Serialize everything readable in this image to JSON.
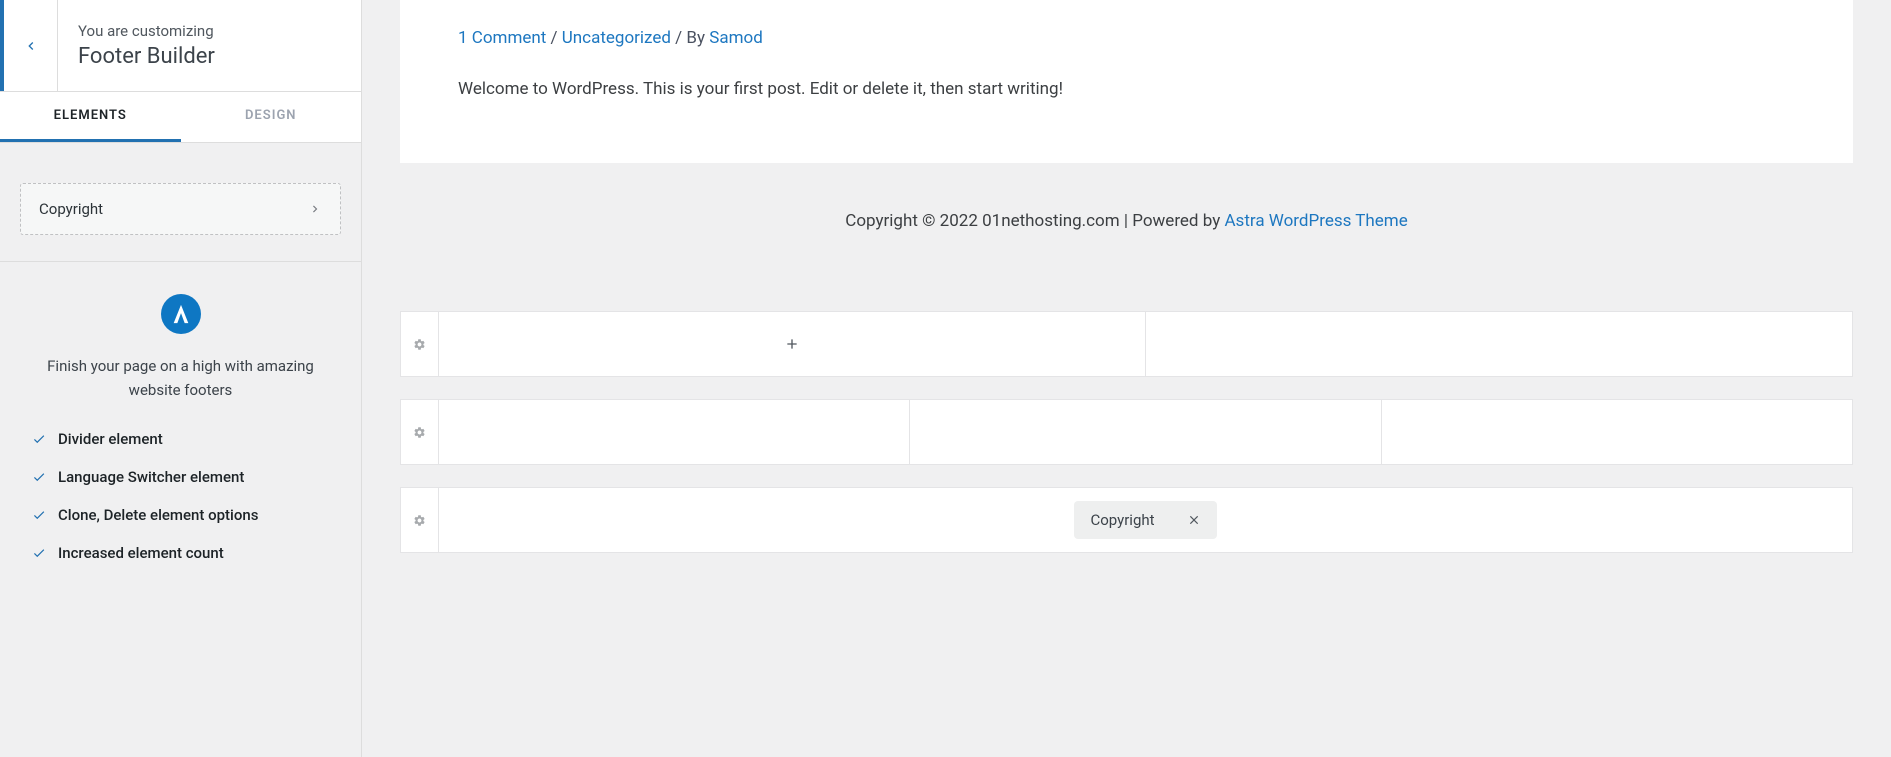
{
  "sidebar": {
    "customizing_label": "You are customizing",
    "panel_title": "Footer Builder",
    "tabs": {
      "elements": "ELEMENTS",
      "design": "DESIGN"
    },
    "element_item": "Copyright",
    "promo": {
      "text": "Finish your page on a high with amazing website footers",
      "features": [
        "Divider element",
        "Language Switcher element",
        "Clone, Delete element options",
        "Increased element count"
      ]
    }
  },
  "preview": {
    "meta": {
      "comments": "1 Comment",
      "category": "Uncategorized",
      "by_label": " / By ",
      "author": "Samod"
    },
    "body": "Welcome to WordPress. This is your first post. Edit or delete it, then start writing!",
    "footer": {
      "copyright_text": "Copyright © 2022 01nethosting.com | Powered by ",
      "theme_link": "Astra WordPress Theme"
    }
  },
  "builder": {
    "copyright_tag": "Copyright"
  }
}
